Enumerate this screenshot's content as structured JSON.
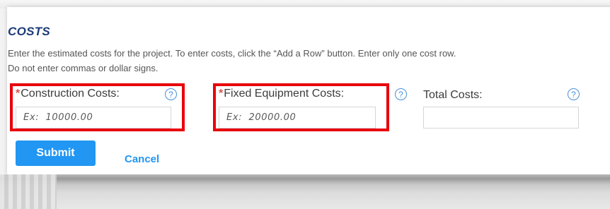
{
  "section": {
    "title": "COSTS",
    "description_line1": "Enter the estimated costs for the project. To enter costs, click the “Add a Row” button. Enter only one cost row.",
    "description_line2": "Do not enter commas or dollar signs."
  },
  "fields": {
    "construction": {
      "required_mark": "*",
      "label": "Construction Costs:",
      "help_icon": "?",
      "value": "",
      "placeholder": "Ex:  10000.00"
    },
    "fixed_equipment": {
      "required_mark": "*",
      "label": "Fixed Equipment Costs:",
      "help_icon": "?",
      "value": "",
      "placeholder": "Ex:  20000.00"
    },
    "total": {
      "label": "Total Costs:",
      "help_icon": "?",
      "value": "",
      "placeholder": ""
    }
  },
  "actions": {
    "submit_label": "Submit",
    "cancel_label": "Cancel"
  },
  "colors": {
    "title": "#1c3a78",
    "required": "#d9534f",
    "accent": "#2196f3",
    "help_icon": "#4a90d9",
    "highlight": "#e8000b"
  }
}
